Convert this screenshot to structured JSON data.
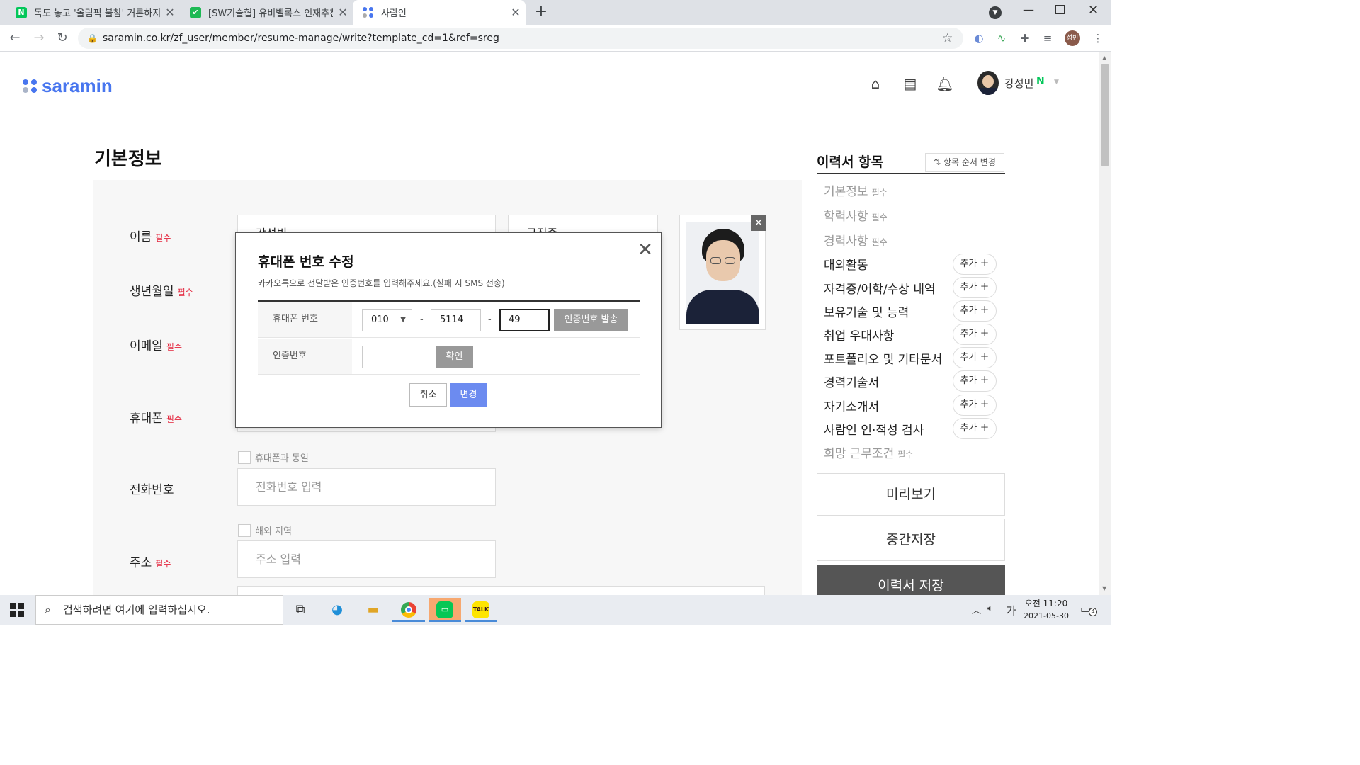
{
  "browser": {
    "tabs": [
      {
        "title": "독도 놓고 '올림픽 불참' 거론하지",
        "favicon_letter": "N",
        "favicon_color": "#03c75a"
      },
      {
        "title": "[SW기술협] 유비벨록스 인재추천",
        "favicon_letter": "",
        "favicon_color": "#1db954"
      },
      {
        "title": "사람인",
        "favicon_letter": "",
        "favicon_color": "#4876ef"
      }
    ],
    "new_tab": "+",
    "url": "saramin.co.kr/zf_user/member/resume-manage/write?template_cd=1&ref=sreg",
    "profile_badge": "성빈"
  },
  "header": {
    "logo": "saramin",
    "user_name": "강성빈",
    "user_badge": "N"
  },
  "form": {
    "section_title": "기본정보",
    "required_mark": "필수",
    "labels": {
      "name": "이름",
      "birth": "생년월일",
      "email": "이메일",
      "mobile": "휴대폰",
      "phone": "전화번호",
      "address": "주소"
    },
    "name_value": "강성빈",
    "job_status": "구직중",
    "same_as_mobile": "휴대폰과 동일",
    "phone_placeholder": "전화번호 입력",
    "overseas": "해외 지역",
    "address_placeholder": "주소 입력"
  },
  "modal": {
    "title": "휴대폰 번호 수정",
    "description": "카카오톡으로 전달받은 인증번호를 입력해주세요.(실패 시 SMS 전송)",
    "phone_label": "휴대폰 번호",
    "phone_prefix": "010",
    "phone_middle": "5114",
    "phone_last": "49",
    "dash": "-",
    "send_button": "인증번호 발송",
    "code_label": "인증번호",
    "confirm_button": "확인",
    "cancel_button": "취소",
    "change_button": "변경"
  },
  "sidebar": {
    "title": "이력서 항목",
    "order_button": "항목 순서 변경",
    "required_mark": "필수",
    "add_label": "추가",
    "items": [
      {
        "label": "기본정보",
        "required": true
      },
      {
        "label": "학력사항",
        "required": true
      },
      {
        "label": "경력사항",
        "required": true
      },
      {
        "label": "대외활동",
        "required": false
      },
      {
        "label": "자격증/어학/수상 내역",
        "required": false
      },
      {
        "label": "보유기술 및 능력",
        "required": false
      },
      {
        "label": "취업 우대사항",
        "required": false
      },
      {
        "label": "포트폴리오 및 기타문서",
        "required": false
      },
      {
        "label": "경력기술서",
        "required": false
      },
      {
        "label": "자기소개서",
        "required": false
      },
      {
        "label": "사람인 인·적성 검사",
        "required": false
      },
      {
        "label": "희망 근무조건",
        "required": true
      }
    ],
    "preview_button": "미리보기",
    "draft_button": "중간저장",
    "save_button": "이력서 저장"
  },
  "taskbar": {
    "search_placeholder": "검색하려면 여기에 입력하십시오.",
    "ime": "가",
    "time": "오전 11:20",
    "date": "2021-05-30",
    "notifications": "4"
  }
}
